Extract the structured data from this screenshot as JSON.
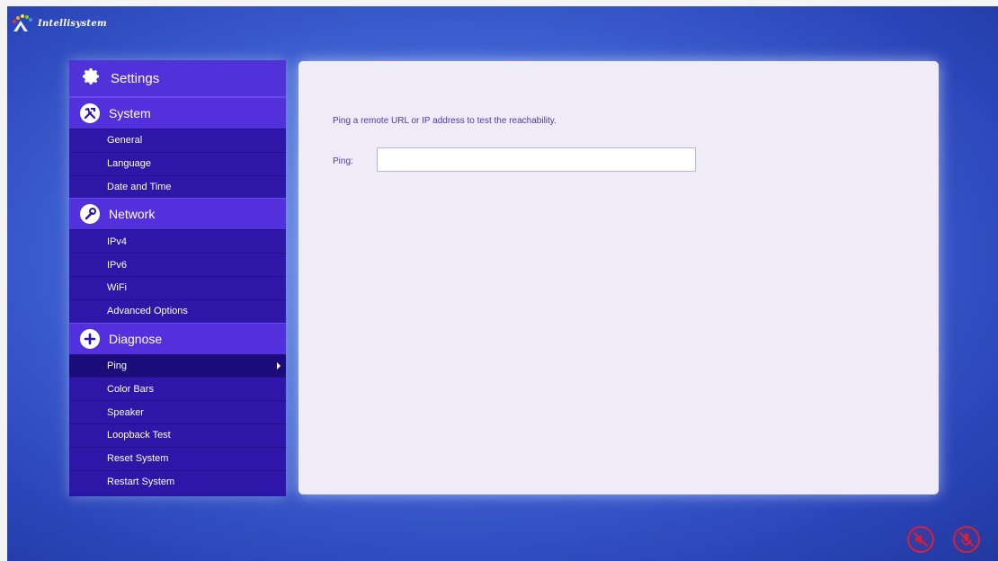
{
  "brand": {
    "logo_text": "Intellisystem"
  },
  "sidebar": {
    "header": {
      "label": "Settings",
      "icon": "gear-icon"
    },
    "sections": [
      {
        "label": "System",
        "icon": "tools-icon",
        "items": [
          {
            "label": "General"
          },
          {
            "label": "Language"
          },
          {
            "label": "Date and Time"
          }
        ]
      },
      {
        "label": "Network",
        "icon": "wrench-icon",
        "items": [
          {
            "label": "IPv4"
          },
          {
            "label": "IPv6"
          },
          {
            "label": "WiFi"
          },
          {
            "label": "Advanced Options"
          }
        ]
      },
      {
        "label": "Diagnose",
        "icon": "plus-icon",
        "items": [
          {
            "label": "Ping",
            "active": true
          },
          {
            "label": "Color Bars"
          },
          {
            "label": "Speaker"
          },
          {
            "label": "Loopback Test"
          },
          {
            "label": "Reset System"
          },
          {
            "label": "Restart System"
          }
        ]
      }
    ]
  },
  "main": {
    "description": "Ping a remote URL or IP address to test the reachability.",
    "ping_label": "Ping:",
    "ping_value": ""
  },
  "status": {
    "speaker_muted_icon": "speaker-muted-icon",
    "mic_muted_icon": "mic-muted-icon",
    "alert_color": "#d6203a"
  }
}
